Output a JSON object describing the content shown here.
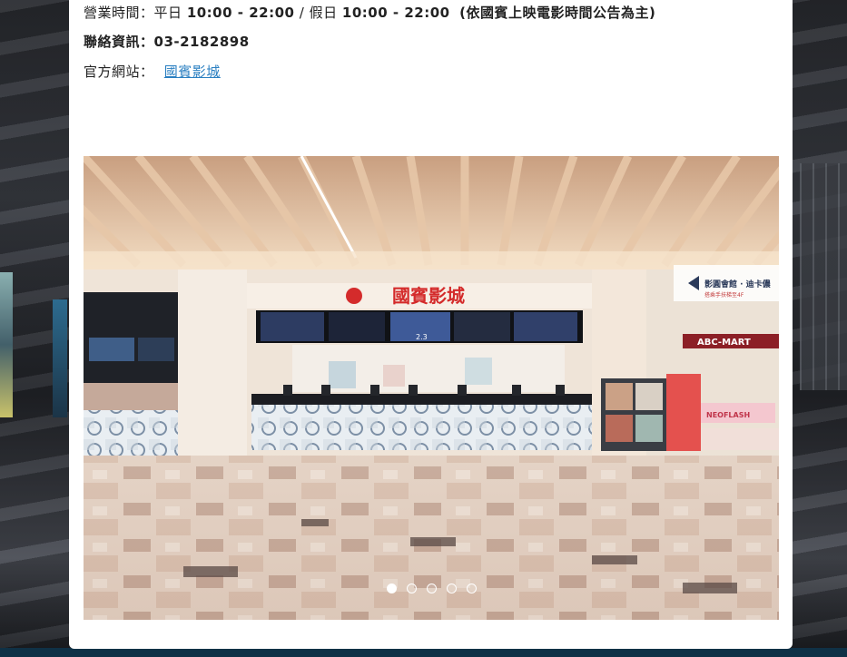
{
  "info": {
    "hours_label": "營業時間：",
    "weekday_label": "平日",
    "weekday_hours": "10:00 - 22:00",
    "separator": "/",
    "holiday_label": "假日",
    "holiday_hours": "10:00 - 22:00",
    "note": "(依國賓上映電影時間公告為主)",
    "contact_label": "聯絡資訊：",
    "phone": "03-2182898",
    "website_label": "官方網站：",
    "website_link": "國賓影城"
  },
  "photo": {
    "cinema_sign": "國賓影城",
    "store_sign": "ABC-MART",
    "direction_sign": "影圓會館 · 迪卡儂",
    "direction_sub": "搭乘手扶梯至4F",
    "shop_sign": "NEOFLASH",
    "poster_caption": "2.3"
  },
  "carousel": {
    "count": 5,
    "active_index": 0
  },
  "colors": {
    "link": "#2a7fc1",
    "sign_red": "#d42b2b",
    "card": "#ffffff"
  }
}
